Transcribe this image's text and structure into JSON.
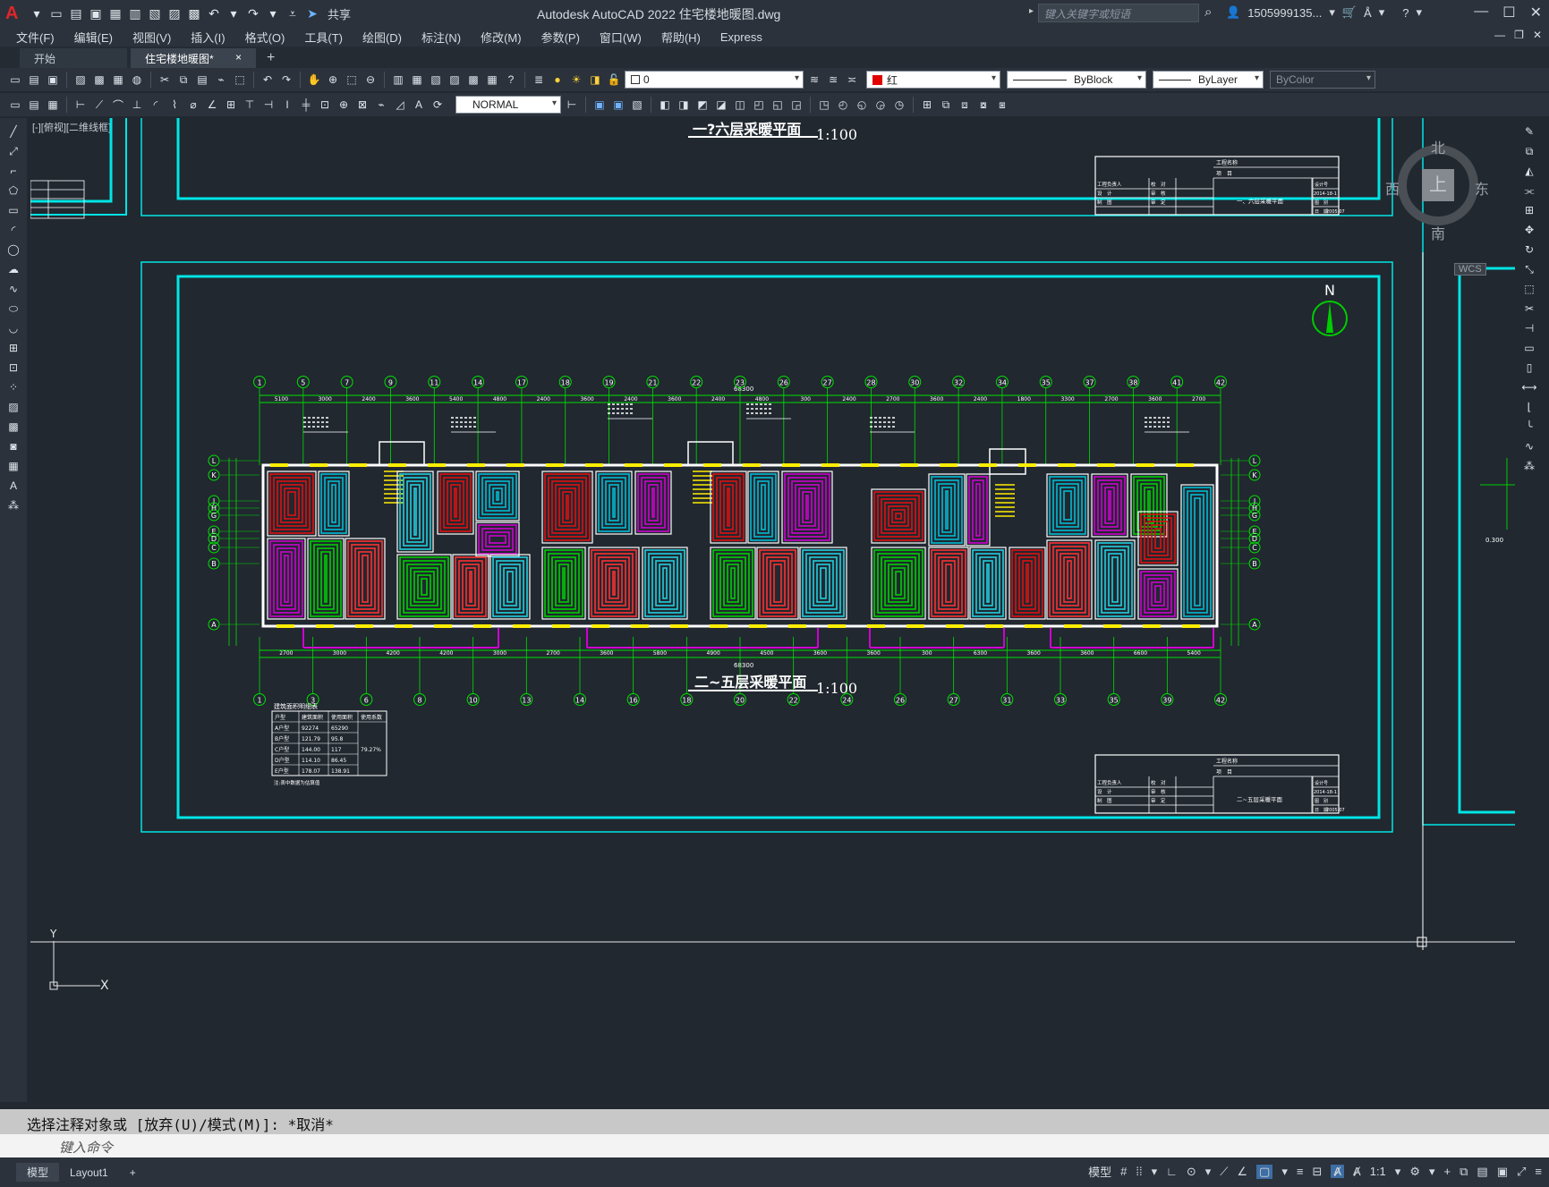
{
  "app": {
    "title": "Autodesk AutoCAD 2022    住宅楼地暖图.dwg",
    "logo": "A",
    "share": "共享",
    "search_placeholder": "键入关键字或短语",
    "user": "1505999135...",
    "accent": "#e0252b"
  },
  "menu": [
    "文件(F)",
    "编辑(E)",
    "视图(V)",
    "插入(I)",
    "格式(O)",
    "工具(T)",
    "绘图(D)",
    "标注(N)",
    "修改(M)",
    "参数(P)",
    "窗口(W)",
    "帮助(H)",
    "Express"
  ],
  "tabs": {
    "start": "开始",
    "active": "住宅楼地暖图*",
    "close": "×",
    "plus": "+"
  },
  "toolbar": {
    "layer": "0",
    "color": "红",
    "linetype": "ByBlock",
    "lineweight": "ByLayer",
    "plotstyle": "ByColor",
    "dimstyle": "NORMAL"
  },
  "viewport_label": "[-][俯视][二维线框]",
  "drawing": {
    "top_title": "一?六层采暖平面",
    "top_scale": "1:100",
    "main_title": "二~五层采暖平面",
    "main_scale": "1:100",
    "north": "N",
    "total_dim": "68300",
    "axes_top": [
      "1",
      "5",
      "7",
      "9",
      "11",
      "14",
      "17",
      "18",
      "19",
      "21",
      "22",
      "23",
      "26",
      "27",
      "28",
      "30",
      "32",
      "34",
      "35",
      "37",
      "38",
      "41",
      "42"
    ],
    "axes_bottom": [
      "1",
      "3",
      "6",
      "8",
      "10",
      "13",
      "14",
      "16",
      "18",
      "20",
      "22",
      "24",
      "26",
      "27",
      "31",
      "33",
      "35",
      "39",
      "42"
    ],
    "axes_side": [
      "L",
      "K",
      "J",
      "H",
      "G",
      "E",
      "D",
      "C",
      "B",
      "A"
    ],
    "dims_top": [
      "5100",
      "3000",
      "2400",
      "3600",
      "5400",
      "4800",
      "2400",
      "3600",
      "2400",
      "3600",
      "2400",
      "4800",
      "300",
      "2400",
      "2700",
      "3600",
      "2400",
      "1800",
      "3300",
      "2700",
      "3600",
      "2700"
    ],
    "dims_bottom": [
      "2700",
      "3000",
      "4200",
      "4200",
      "3000",
      "2700",
      "3600",
      "5800",
      "4900",
      "4500",
      "3600",
      "3600",
      "300",
      "6300",
      "3600",
      "3600",
      "6600",
      "5400"
    ],
    "titleblock": [
      "工程名称",
      "项　目",
      "工程负责人",
      "校　对",
      "设　计",
      "审　核",
      "制　图",
      "审　定",
      "设计号",
      "2014-18-1",
      "图　别",
      "暖施",
      "图　号",
      "日　期",
      "2005.07"
    ],
    "top_tb_name": "一、六层采暖平面",
    "main_tb_name": "二~五层采暖平面",
    "table_title": "建筑面积明细表",
    "table_rows": [
      [
        "户型",
        "建筑面积",
        "使用面积",
        "使用系数"
      ],
      [
        "A户型",
        "92274",
        "65290",
        ""
      ],
      [
        "B户型",
        "121.79",
        "95.8",
        ""
      ],
      [
        "C户型",
        "144.00",
        "117",
        "79.27%"
      ],
      [
        "D户型",
        "114.10",
        "86.45",
        ""
      ],
      [
        "E户型",
        "178.07",
        "138.91",
        ""
      ]
    ],
    "table_note": "注:表中数据为估算值"
  },
  "compass": {
    "n": "北",
    "s": "南",
    "e": "东",
    "w": "西",
    "top": "上",
    "wcs": "WCS"
  },
  "cmd": {
    "history": "选择注释对象或 [放弃(U)/模式(M)]: *取消*",
    "placeholder": "键入命令"
  },
  "layouts": [
    "模型",
    "Layout1",
    "+"
  ],
  "status": {
    "model": "模型",
    "scale": "1:1"
  }
}
